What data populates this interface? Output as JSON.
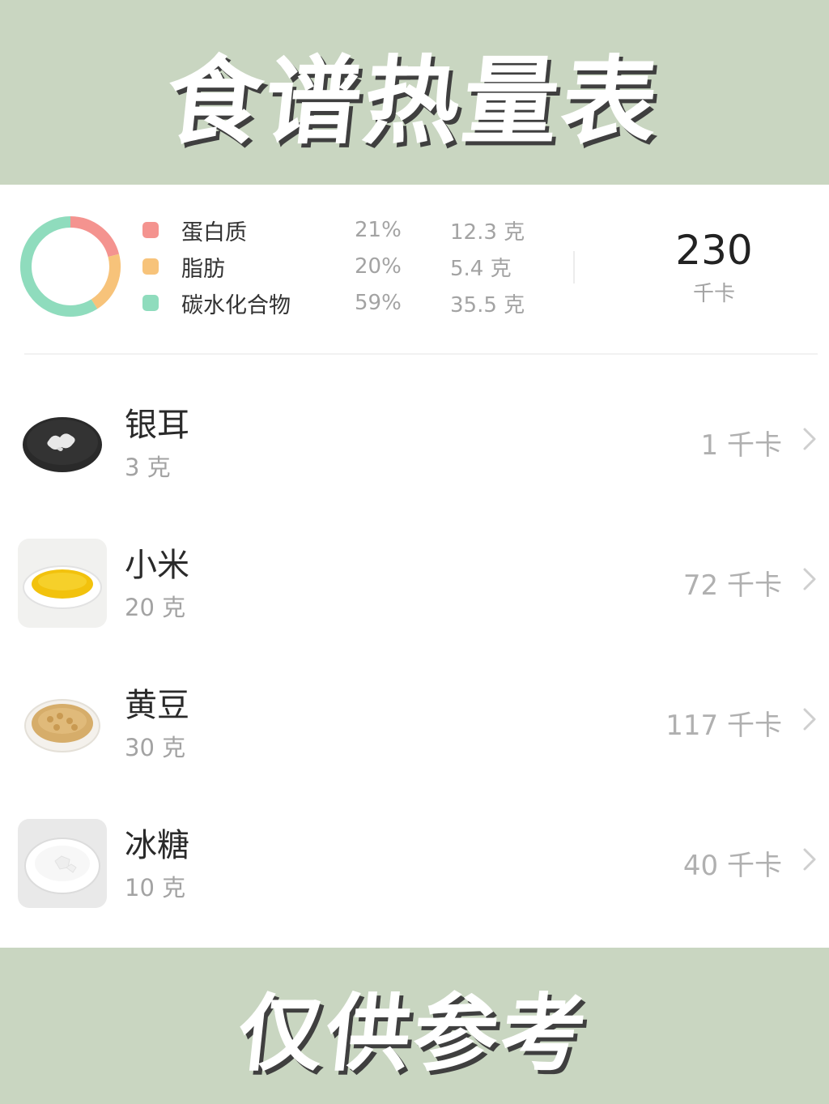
{
  "header": {
    "title": "食谱热量表"
  },
  "footer": {
    "note": "仅供参考"
  },
  "summary": {
    "macros": [
      {
        "name": "蛋白质",
        "percent": "21%",
        "amount": "12.3 克",
        "color": "#f4938f",
        "share": 0.21
      },
      {
        "name": "脂肪",
        "percent": "20%",
        "amount": "5.4 克",
        "color": "#f7c37a",
        "share": 0.2
      },
      {
        "name": "碳水化合物",
        "percent": "59%",
        "amount": "35.5 克",
        "color": "#8fdcbd",
        "share": 0.59
      }
    ],
    "total_value": "230",
    "total_unit": "千卡"
  },
  "ingredients": [
    {
      "name": "银耳",
      "quantity": "3 克",
      "calories": "1 千卡",
      "image_icon": "white-fungus-plate-icon"
    },
    {
      "name": "小米",
      "quantity": "20 克",
      "calories": "72 千卡",
      "image_icon": "millet-plate-icon"
    },
    {
      "name": "黄豆",
      "quantity": "30 克",
      "calories": "117 千卡",
      "image_icon": "soybean-plate-icon"
    },
    {
      "name": "冰糖",
      "quantity": "10 克",
      "calories": "40 千卡",
      "image_icon": "rock-sugar-plate-icon"
    }
  ]
}
